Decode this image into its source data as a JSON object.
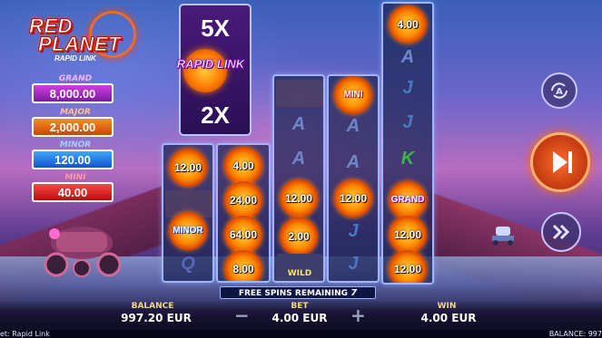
{
  "logo": {
    "line1": "RED",
    "line2": "PLANET",
    "line3": "RAPID LINK"
  },
  "jackpots": [
    {
      "name": "GRAND",
      "value": "8,000.00"
    },
    {
      "name": "MAJOR",
      "value": "2,000.00"
    },
    {
      "name": "MINOR",
      "value": "120.00"
    },
    {
      "name": "MINI",
      "value": "40.00"
    }
  ],
  "multiplier": {
    "top": "5X",
    "bottom": "2X",
    "rapid_link": "RAPID LINK"
  },
  "reels": {
    "reel1": [
      "12.00",
      "MINOR"
    ],
    "reel2": [
      "4.00",
      "24.00",
      "64.00",
      "8.00"
    ],
    "reel3": [
      "12.00",
      "2.00",
      "WILD"
    ],
    "reel4": [
      "MINI",
      "12.00"
    ],
    "reel5": [
      "4.00",
      "GRAND",
      "12.00",
      "12.00"
    ],
    "symbols": {
      "a": "A",
      "j": "J",
      "k": "K",
      "q": "Q"
    }
  },
  "free_spins": {
    "label": "FREE SPINS REMAINING",
    "count": "7"
  },
  "balance": {
    "label": "BALANCE",
    "value": "997.20 EUR"
  },
  "bet": {
    "label": "BET",
    "value": "4.00 EUR",
    "minus": "−",
    "plus": "+"
  },
  "win": {
    "label": "WIN",
    "value": "4.00 EUR"
  },
  "footer": {
    "left": "et: Rapid Link",
    "right": "BALANCE: 997"
  },
  "colors": {
    "grand": "#b12ed0",
    "major": "#e86a10",
    "minor": "#2370e0",
    "mini": "#d62020",
    "spin": "#ff6a2a"
  },
  "icons": {
    "autoplay": "autoplay-icon",
    "spin": "play-skip-icon",
    "turbo": "fast-forward-icon"
  }
}
